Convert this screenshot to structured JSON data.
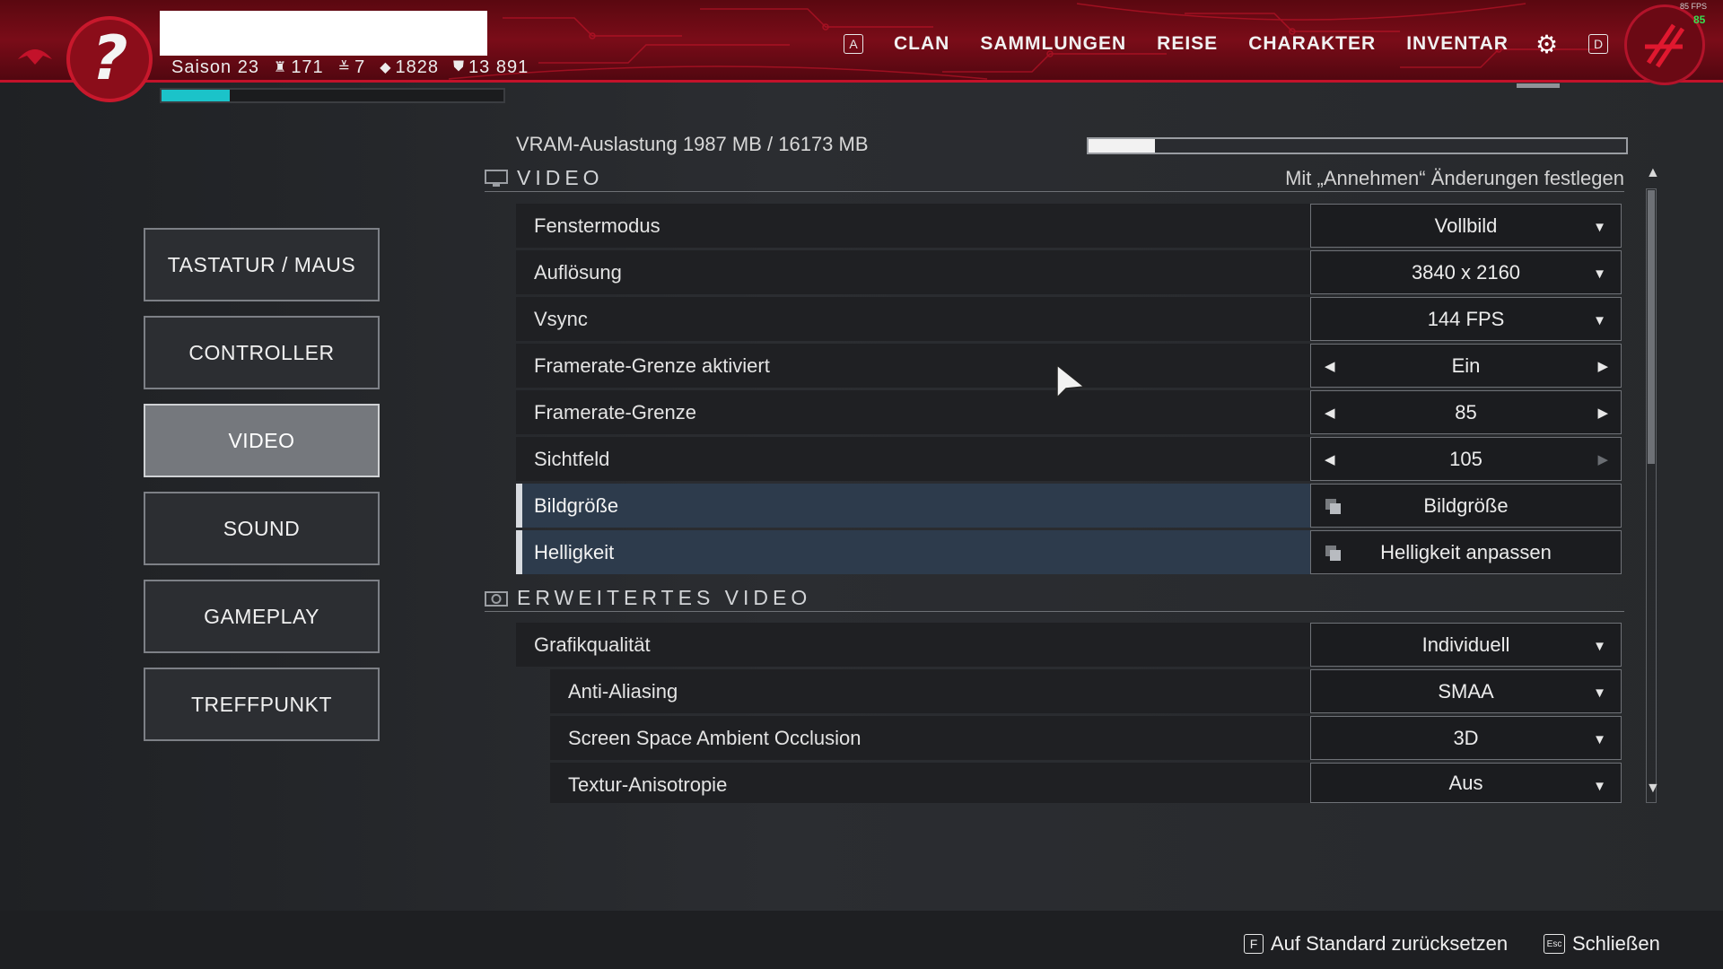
{
  "header": {
    "season": "Saison 23",
    "stats": [
      {
        "icon": "tower-icon",
        "value": "171"
      },
      {
        "icon": "rank-chevrons-icon",
        "value": "7"
      },
      {
        "icon": "diamond-icon",
        "value": "1828"
      },
      {
        "icon": "shield-icon",
        "value": "13 891"
      }
    ],
    "xp_progress": 0.2,
    "nav_left_key": "A",
    "nav": [
      "CLAN",
      "SAMMLUNGEN",
      "REISE",
      "CHARAKTER",
      "INVENTAR"
    ],
    "nav_right_key": "D",
    "fps_label": "85 FPS",
    "fps_value": "85",
    "accent_color": "#c3122a"
  },
  "menu": {
    "items": [
      "TASTATUR / MAUS",
      "CONTROLLER",
      "VIDEO",
      "SOUND",
      "GAMEPLAY",
      "TREFFPUNKT"
    ],
    "active": "VIDEO"
  },
  "vram": {
    "label": "VRAM-Auslastung 1987 MB / 16173 MB",
    "used_mb": 1987,
    "total_mb": 16173
  },
  "video": {
    "title": "VIDEO",
    "hint": "Mit „Annehmen“ Änderungen festlegen",
    "rows": [
      {
        "label": "Fenstermodus",
        "value": "Vollbild",
        "type": "dropdown"
      },
      {
        "label": "Auflösung",
        "value": "3840 x 2160",
        "type": "dropdown"
      },
      {
        "label": "Vsync",
        "value": "144 FPS",
        "type": "dropdown"
      },
      {
        "label": "Framerate-Grenze aktiviert",
        "value": "Ein",
        "type": "stepper"
      },
      {
        "label": "Framerate-Grenze",
        "value": "85",
        "type": "stepper"
      },
      {
        "label": "Sichtfeld",
        "value": "105",
        "type": "stepper"
      },
      {
        "label": "Bildgröße",
        "value": "Bildgröße",
        "type": "popup"
      },
      {
        "label": "Helligkeit",
        "value": "Helligkeit anpassen",
        "type": "popup"
      }
    ]
  },
  "advanced": {
    "title": "ERWEITERTES VIDEO",
    "rows": [
      {
        "label": "Grafikqualität",
        "value": "Individuell",
        "type": "dropdown"
      },
      {
        "label": "Anti-Aliasing",
        "value": "SMAA",
        "type": "dropdown"
      },
      {
        "label": "Screen Space Ambient Occlusion",
        "value": "3D",
        "type": "dropdown"
      },
      {
        "label": "Textur-Anisotropie",
        "value": "Aus",
        "type": "dropdown"
      }
    ]
  },
  "footer": {
    "reset_key": "F",
    "reset_label": "Auf Standard zurücksetzen",
    "close_key": "Esc",
    "close_label": "Schließen"
  }
}
